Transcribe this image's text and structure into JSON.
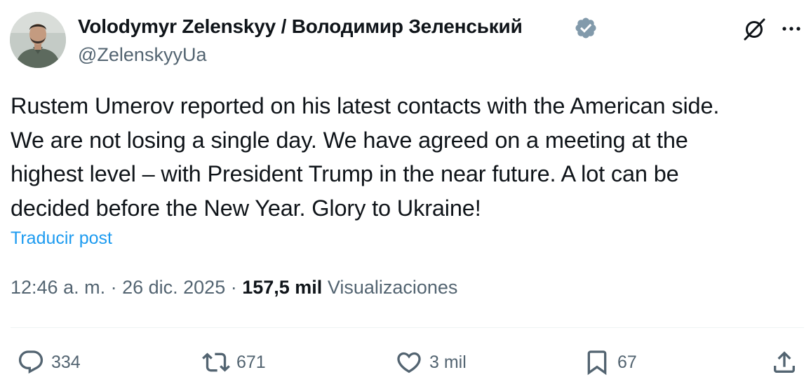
{
  "tweet": {
    "author": {
      "name": "Volodymyr Zelenskyy / Володимир Зеленський",
      "handle": "@ZelenskyyUa",
      "verified": true
    },
    "text": "Rustem Umerov reported on his latest contacts with the American side.\nWe are not losing a single day. We have agreed on a meeting at the\nhighest level – with President Trump in the near future. A lot can be\ndecided before the New Year. Glory to Ukraine!",
    "translate_label": "Traducir post",
    "time": "12:46 a. m.",
    "separator": " · ",
    "date": "26 dic. 2025",
    "views_count": "157,5 mil",
    "views_label": "Visualizaciones",
    "actions": {
      "replies": "334",
      "reposts": "671",
      "likes": "3 mil",
      "bookmarks": "67"
    }
  },
  "icons": {
    "verified": "verified-badge-icon",
    "grok": "grok-icon",
    "more": "more-icon",
    "reply": "reply-icon",
    "repost": "repost-icon",
    "like": "heart-icon",
    "bookmark": "bookmark-icon",
    "share": "share-icon"
  },
  "colors": {
    "text_primary": "#0f1419",
    "text_secondary": "#536471",
    "link": "#1d9bf0",
    "verified_badge": "#829aab",
    "divider": "#eff3f4"
  }
}
